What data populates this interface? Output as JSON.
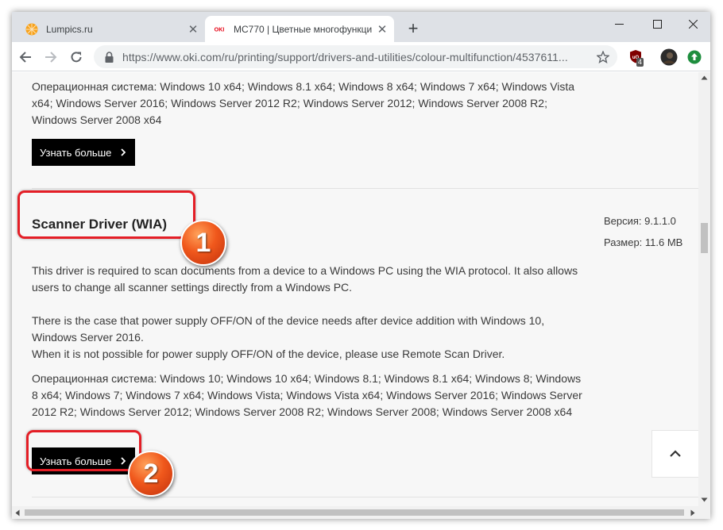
{
  "browser": {
    "tabs": [
      {
        "title": "Lumpics.ru",
        "favicon": "orange-circle-icon"
      },
      {
        "title": "MC770 | Цветные многофункци",
        "favicon": "oki-logo",
        "favicon_text": "OKI"
      }
    ],
    "url": "https://www.oki.com/ru/printing/support/drivers-and-utilities/colour-multifunction/4537611...",
    "extension_badge": "4"
  },
  "content": {
    "prev_os_text": "Операционная система: Windows 10 x64; Windows 8.1 x64; Windows 8 x64; Windows 7 x64; Windows Vista x64; Windows Server 2016; Windows Server 2012 R2; Windows Server 2012; Windows Server 2008 R2; Windows Server 2008 x64",
    "more_button_1": "Узнать больше",
    "driver": {
      "title": "Scanner Driver (WIA)",
      "version_label": "Версия: 9.1.1.0",
      "size_label": "Размер: 11.6 MB",
      "description": "This driver is required to scan documents from a device to a Windows PC using the WIA protocol. It also allows users to change all scanner settings directly from a Windows PC.",
      "note_1": "There is the case that power supply OFF/ON of the device needs after device addition with Windows 10, Windows Server 2016.",
      "note_2": "When it is not possible for power supply OFF/ON of the device, please use Remote Scan Driver.",
      "os_text": "Операционная система: Windows 10; Windows 10 x64; Windows 8.1; Windows 8.1 x64; Windows 8; Windows 8 x64; Windows 7; Windows 7 x64; Windows Vista; Windows Vista x64; Windows Server 2016; Windows Server 2012 R2; Windows Server 2012; Windows Server 2008 R2; Windows Server 2008; Windows Server 2008 x64",
      "more_button": "Узнать больше"
    }
  },
  "annotations": {
    "badge_1": "1",
    "badge_2": "2",
    "highlight_color": "#e41e26"
  }
}
